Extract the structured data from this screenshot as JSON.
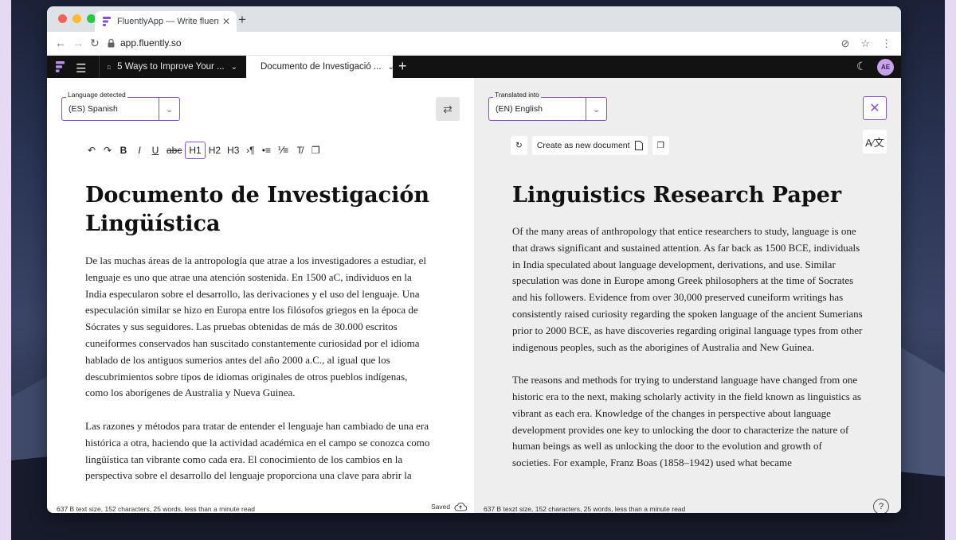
{
  "browser": {
    "tab_title": "FluentlyApp — Write fluently in",
    "tab_close": "✕",
    "new_tab": "+",
    "url": "app.fluently.so"
  },
  "app": {
    "doc_tabs": [
      {
        "label": "5 Ways to Improve Your ..."
      },
      {
        "label": "Documento de Investigació ..."
      }
    ],
    "add_tab": "+",
    "avatar_initials": "AE",
    "accent_color": "#8a4fd1"
  },
  "left": {
    "language_label": "Language detected",
    "language_value": "(ES)  Spanish",
    "toolbar": [
      "↶",
      "↷",
      "B",
      "I",
      "U",
      "abc",
      "H1",
      "H2",
      "H3",
      "›¶",
      "•≡",
      "⅟≡",
      "T̸",
      "❐"
    ],
    "title_line1": "Documento de Investigación",
    "title_line2": "Lingüística",
    "paragraphs": [
      "De las muchas áreas de la antropología que atrae a los investigadores a estudiar, el lenguaje es uno que atrae una atención sostenida. En 1500 aC, individuos en la India especularon sobre el desarrollo, las derivaciones y el uso del lenguaje. Una especulación similar se hizo en Europa entre los filósofos griegos en la época de Sócrates y sus seguidores. Las pruebas obtenidas de más de 30.000 escritos cuneiformes conservados han suscitado constantemente curiosidad por el idioma hablado de los antiguos sumerios antes del año 2000 a.C., al igual que los descubrimientos sobre tipos de idiomas originales de otros pueblos indígenas, como los aborígenes de Australia y Nueva Guinea.",
      "Las razones y métodos para tratar de entender el lenguaje han cambiado de una era histórica a otra, haciendo que la actividad académica en el campo se conozca como lingüística tan vibrante como cada era. El conocimiento de los cambios en la perspectiva sobre el desarrollo del lenguaje proporciona una clave para abrir la puerta"
    ],
    "status": "637 B text size, 152 characters, 25 words, less than a minute read",
    "saved": "Saved"
  },
  "right": {
    "language_label": "Translated into",
    "language_value": "(EN)  English",
    "create_label": "Create as new document",
    "title": "Linguistics Research Paper",
    "paragraphs": [
      "Of the many areas of anthropology that entice researchers to study, language is one that draws significant and sustained attention. As far back as 1500 BCE, individuals in India speculated about language development, derivations, and use. Similar speculation was done in Europe among Greek philosophers at the time of Socrates and his followers. Evidence from over 30,000 preserved cuneiform writings has consistently raised curiosity regarding the spoken language of the ancient Sumerians prior to 2000 BCE, as have discoveries regarding original language types from other indigenous peoples, such as the aborigines of Australia and New Guinea.",
      "The reasons and methods for trying to understand language have changed from one historic era to the next, making scholarly activity in the field known as linguistics as vibrant as each era. Knowledge of the changes in perspective about language development provides one key to unlocking the door to characterize the nature of human beings as well as unlocking the door to the evolution and growth of societies. For example, Franz Boas (1858–1942) used what became"
    ],
    "status": "637 B texzt size, 152 characters, 25 words, less than a minute read",
    "help": "?"
  }
}
